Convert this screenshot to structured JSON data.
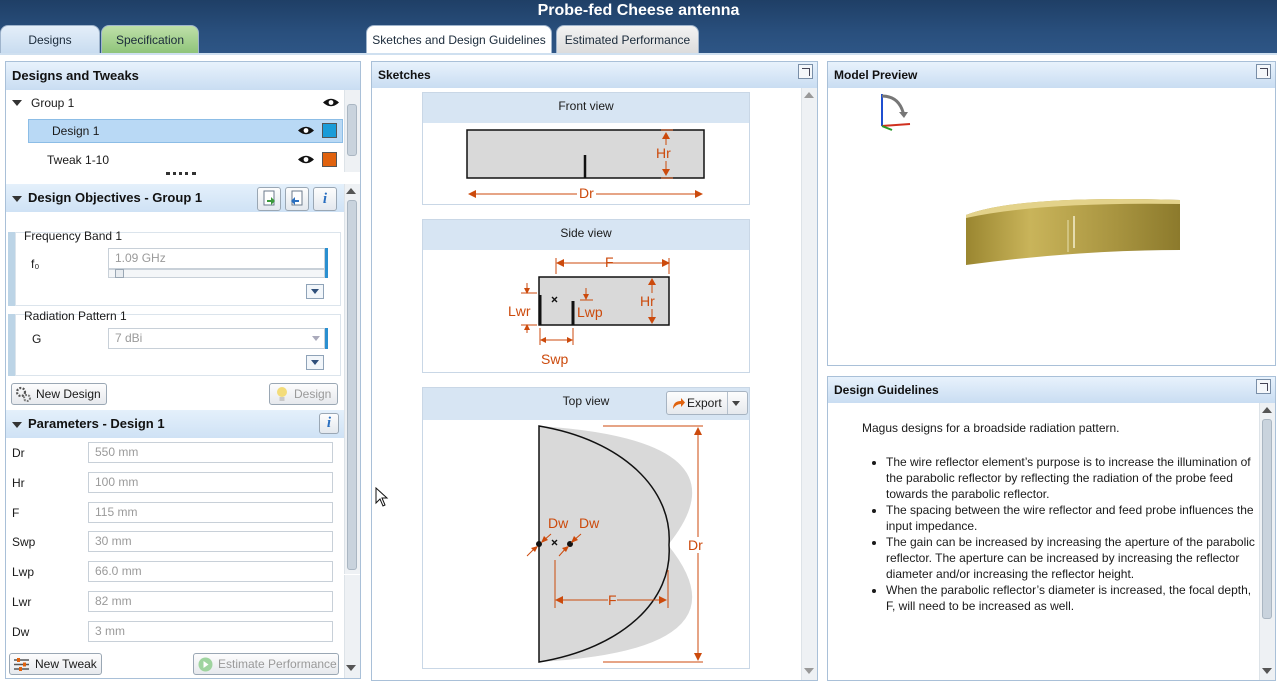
{
  "app": {
    "title": "Probe-fed Cheese antenna"
  },
  "tabs": {
    "designs": "Designs",
    "specification": "Specification",
    "sketches": "Sketches and Design Guidelines",
    "performance": "Estimated Performance"
  },
  "designs_panel": {
    "title": "Designs and Tweaks",
    "group": "Group 1",
    "design": "Design 1",
    "tweak": "Tweak 1-10",
    "design_color": "#1a9cd8",
    "tweak_color": "#e0620e"
  },
  "objectives": {
    "title": "Design Objectives  -  Group 1",
    "freq_label": "Frequency Band 1",
    "f0_label": "f₀",
    "f0_value": "1.09 GHz",
    "f0_slider_fraction": 0.03,
    "rad_label": "Radiation Pattern 1",
    "g_label": "G",
    "g_value": "7 dBi",
    "new_design": "New Design",
    "design_button": "Design"
  },
  "parameters": {
    "title": "Parameters  -  Design 1",
    "rows": [
      {
        "name": "Dr",
        "value": "550 mm"
      },
      {
        "name": "Hr",
        "value": "100 mm"
      },
      {
        "name": "F",
        "value": "115 mm"
      },
      {
        "name": "Swp",
        "value": "30 mm"
      },
      {
        "name": "Lwp",
        "value": "66.0 mm"
      },
      {
        "name": "Lwr",
        "value": "82 mm"
      },
      {
        "name": "Dw",
        "value": "3 mm"
      }
    ],
    "new_tweak": "New Tweak",
    "estimate": "Estimate Performance"
  },
  "sketches": {
    "title": "Sketches",
    "front_view": "Front view",
    "side_view": "Side view",
    "top_view": "Top view",
    "export": "Export",
    "labels": {
      "Hr": "Hr",
      "Dr": "Dr",
      "F": "F",
      "Lwr": "Lwr",
      "Lwp": "Lwp",
      "Swp": "Swp",
      "Dw": "Dw"
    }
  },
  "model_preview": {
    "title": "Model Preview"
  },
  "guidelines": {
    "title": "Design Guidelines",
    "intro": "Magus designs for a broadside radiation pattern.",
    "bullets": [
      "The wire reflector element’s purpose is to increase the illumination of the parabolic reflector by reflecting the radiation of the probe feed towards the parabolic reflector.",
      "The spacing between the wire reflector and feed probe influences the input impedance.",
      "The gain can be increased by increasing the aperture of the parabolic reflector. The aperture can be increased by increasing the reflector diameter and/or increasing the reflector height.",
      "When the parabolic reflector’s diameter is increased, the focal depth, F, will need to be increased as well."
    ]
  },
  "colors": {
    "accent": "#cc4a0c",
    "header": "#294f7d",
    "panel_head": "#c9ddf2"
  }
}
